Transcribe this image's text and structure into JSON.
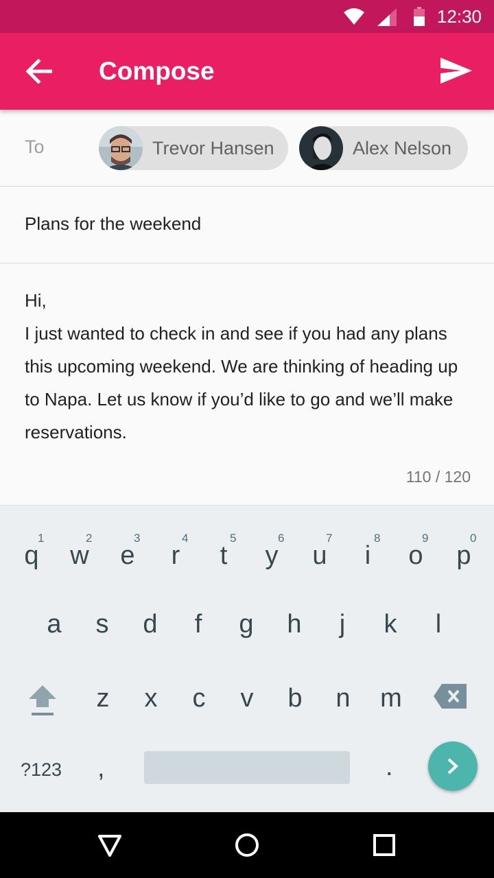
{
  "status_bar": {
    "time": "12:30",
    "icons": [
      "wifi-icon",
      "signal-icon",
      "battery-icon"
    ]
  },
  "app_bar": {
    "title": "Compose",
    "back_icon": "arrow-left-icon",
    "send_icon": "send-icon"
  },
  "compose": {
    "to_label": "To",
    "recipients": [
      {
        "name": "Trevor Hansen"
      },
      {
        "name": "Alex Nelson"
      }
    ],
    "subject": "Plans for the weekend",
    "body": "Hi,\nI just wanted to check in and see if you had any plans this upcoming weekend. We are thinking of heading up to Napa. Let us know if you’d like to go and we’ll make reservations.",
    "char_count": "110 / 120"
  },
  "keyboard": {
    "row1": [
      {
        "k": "q",
        "h": "1"
      },
      {
        "k": "w",
        "h": "2"
      },
      {
        "k": "e",
        "h": "3"
      },
      {
        "k": "r",
        "h": "4"
      },
      {
        "k": "t",
        "h": "5"
      },
      {
        "k": "y",
        "h": "6"
      },
      {
        "k": "u",
        "h": "7"
      },
      {
        "k": "i",
        "h": "8"
      },
      {
        "k": "o",
        "h": "9"
      },
      {
        "k": "p",
        "h": "0"
      }
    ],
    "row2": [
      "a",
      "s",
      "d",
      "f",
      "g",
      "h",
      "j",
      "k",
      "l"
    ],
    "row3": [
      "z",
      "x",
      "c",
      "v",
      "b",
      "n",
      "m"
    ],
    "symbols_label": "?123",
    "comma": ",",
    "period": "."
  },
  "colors": {
    "primary": "#e91e63",
    "primary_dark": "#c2185b",
    "accent": "#4db6ac"
  }
}
